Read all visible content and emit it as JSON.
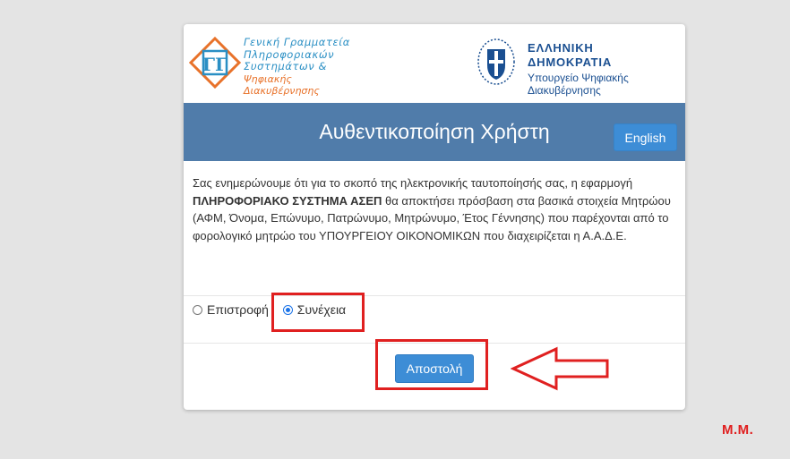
{
  "branding": {
    "gsis_lines": [
      "Γενική Γραμματεία",
      "Πληροφοριακών",
      "Συστημάτων &"
    ],
    "gsis_orange_line": "Ψηφιακής Διακυβέρνησης",
    "gov_title": "ΕΛΛΗΝΙΚΗ ΔΗΜΟΚΡΑΤΙΑ",
    "gov_sub_1": "Υπουργείο Ψηφιακής",
    "gov_sub_2": "Διακυβέρνησης"
  },
  "header": {
    "title": "Αυθεντικοποίηση Χρήστη",
    "language_button": "English"
  },
  "notice": {
    "part1": "Σας ενημερώνουμε ότι για το σκοπό της ηλεκτρονικής ταυτοποίησής σας, η εφαρμογή",
    "system_name": "ΠΛΗΡΟΦΟΡΙΑΚΟ ΣΥΣΤΗΜΑ ΑΣΕΠ",
    "part2": "θα αποκτήσει πρόσβαση στα βασικά στοιχεία Μητρώου (ΑΦΜ, Όνομα, Επώνυμο, Πατρώνυμο, Μητρώνυμο, Έτος Γέννησης) που παρέχονται από το φορολογικό μητρώο του ΥΠΟΥΡΓΕΙΟΥ ΟΙΚΟΝΟΜΙΚΩΝ που διαχειρίζεται η Α.Α.Δ.Ε."
  },
  "options": [
    {
      "label": "Επιστροφή",
      "checked": false
    },
    {
      "label": "Συνέχεια",
      "checked": true
    }
  ],
  "submit_label": "Αποστολή",
  "signature": "Μ.Μ.",
  "colors": {
    "header_bg": "#507caa",
    "button_bg": "#3d8dd6",
    "annotation_red": "#e02020"
  }
}
